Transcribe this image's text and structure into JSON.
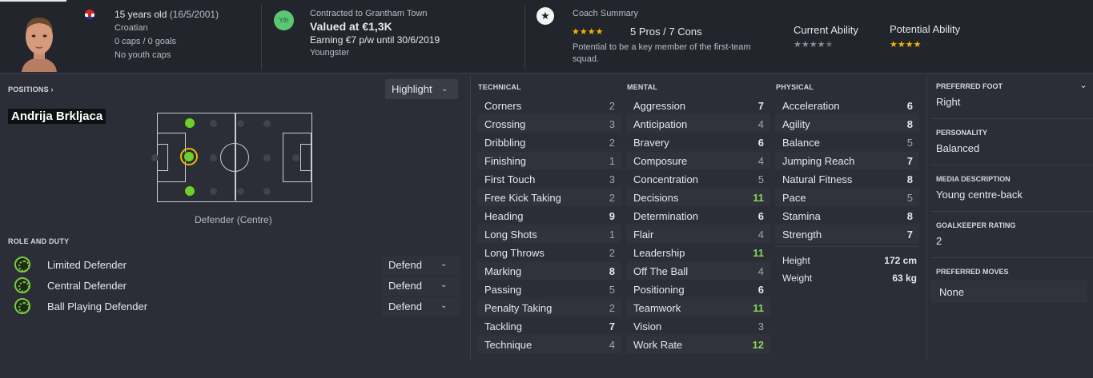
{
  "profile": {
    "age": "15 years old",
    "dob": "(16/5/2001)",
    "nationality": "Croatian",
    "caps": "0 caps / 0 goals",
    "youth": "No youth caps"
  },
  "contract": {
    "badge": "Yth",
    "club_line": "Contracted to Grantham Town",
    "value": "Valued at €1,3K",
    "earning": "Earning €7 p/w until 30/6/2019",
    "status": "Youngster"
  },
  "coach": {
    "title": "Coach Summary",
    "pros_cons": "5 Pros / 7 Cons",
    "stars": 4,
    "summary": "Potential to be a key member of the first-team squad.",
    "current_label": "Current Ability",
    "current_stars": 4.5,
    "potential_label": "Potential Ability",
    "potential_stars": 4,
    "star_color": "#f2b705"
  },
  "positions": {
    "header": "POSITIONS",
    "name": "Andrija Brkljaca",
    "highlight": "Highlight",
    "position_label": "Defender (Centre)"
  },
  "roles": {
    "header": "ROLE AND DUTY",
    "items": [
      {
        "role": "Limited Defender",
        "duty": "Defend"
      },
      {
        "role": "Central Defender",
        "duty": "Defend"
      },
      {
        "role": "Ball Playing Defender",
        "duty": "Defend"
      }
    ]
  },
  "technical": {
    "header": "TECHNICAL",
    "attrs": [
      {
        "name": "Corners",
        "value": "2"
      },
      {
        "name": "Crossing",
        "value": "3"
      },
      {
        "name": "Dribbling",
        "value": "2"
      },
      {
        "name": "Finishing",
        "value": "1"
      },
      {
        "name": "First Touch",
        "value": "3"
      },
      {
        "name": "Free Kick Taking",
        "value": "2"
      },
      {
        "name": "Heading",
        "value": "9"
      },
      {
        "name": "Long Shots",
        "value": "1"
      },
      {
        "name": "Long Throws",
        "value": "2"
      },
      {
        "name": "Marking",
        "value": "8"
      },
      {
        "name": "Passing",
        "value": "5"
      },
      {
        "name": "Penalty Taking",
        "value": "2"
      },
      {
        "name": "Tackling",
        "value": "7"
      },
      {
        "name": "Technique",
        "value": "4"
      }
    ]
  },
  "mental": {
    "header": "MENTAL",
    "attrs": [
      {
        "name": "Aggression",
        "value": "7"
      },
      {
        "name": "Anticipation",
        "value": "4"
      },
      {
        "name": "Bravery",
        "value": "6"
      },
      {
        "name": "Composure",
        "value": "4"
      },
      {
        "name": "Concentration",
        "value": "5"
      },
      {
        "name": "Decisions",
        "value": "11"
      },
      {
        "name": "Determination",
        "value": "6"
      },
      {
        "name": "Flair",
        "value": "4"
      },
      {
        "name": "Leadership",
        "value": "11"
      },
      {
        "name": "Off The Ball",
        "value": "4"
      },
      {
        "name": "Positioning",
        "value": "6"
      },
      {
        "name": "Teamwork",
        "value": "11"
      },
      {
        "name": "Vision",
        "value": "3"
      },
      {
        "name": "Work Rate",
        "value": "12"
      }
    ]
  },
  "physical": {
    "header": "PHYSICAL",
    "attrs": [
      {
        "name": "Acceleration",
        "value": "6"
      },
      {
        "name": "Agility",
        "value": "8"
      },
      {
        "name": "Balance",
        "value": "5"
      },
      {
        "name": "Jumping Reach",
        "value": "7"
      },
      {
        "name": "Natural Fitness",
        "value": "8"
      },
      {
        "name": "Pace",
        "value": "5"
      },
      {
        "name": "Stamina",
        "value": "8"
      },
      {
        "name": "Strength",
        "value": "7"
      }
    ],
    "height_label": "Height",
    "height": "172 cm",
    "weight_label": "Weight",
    "weight": "63 kg"
  },
  "info": {
    "foot_label": "PREFERRED FOOT",
    "foot": "Right",
    "personality_label": "PERSONALITY",
    "personality": "Balanced",
    "media_label": "MEDIA DESCRIPTION",
    "media": "Young centre-back",
    "gk_label": "GOALKEEPER RATING",
    "gk": "2",
    "moves_label": "PREFERRED MOVES",
    "moves": "None"
  }
}
